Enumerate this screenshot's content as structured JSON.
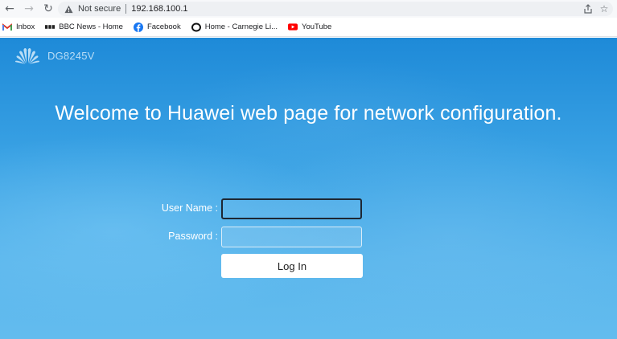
{
  "browser": {
    "security_label": "Not secure",
    "url": "192.168.100.1",
    "bookmarks": [
      {
        "label": "Inbox",
        "icon": "gmail-icon"
      },
      {
        "label": "BBC News - Home",
        "icon": "bbc-icon"
      },
      {
        "label": "Facebook",
        "icon": "facebook-icon"
      },
      {
        "label": "Home - Carnegie Li...",
        "icon": "carnegie-icon"
      },
      {
        "label": "YouTube",
        "icon": "youtube-icon"
      }
    ]
  },
  "page": {
    "brand": "DG8245V",
    "welcome": "Welcome to Huawei web page for network configuration.",
    "form": {
      "username_label": "User Name :",
      "username_value": "",
      "password_label": "Password :",
      "password_value": "",
      "login_label": "Log In"
    }
  },
  "colors": {
    "page_background": "#3aa2e4",
    "brand_text": "#b9ddf6",
    "button_background": "#ffffff"
  }
}
